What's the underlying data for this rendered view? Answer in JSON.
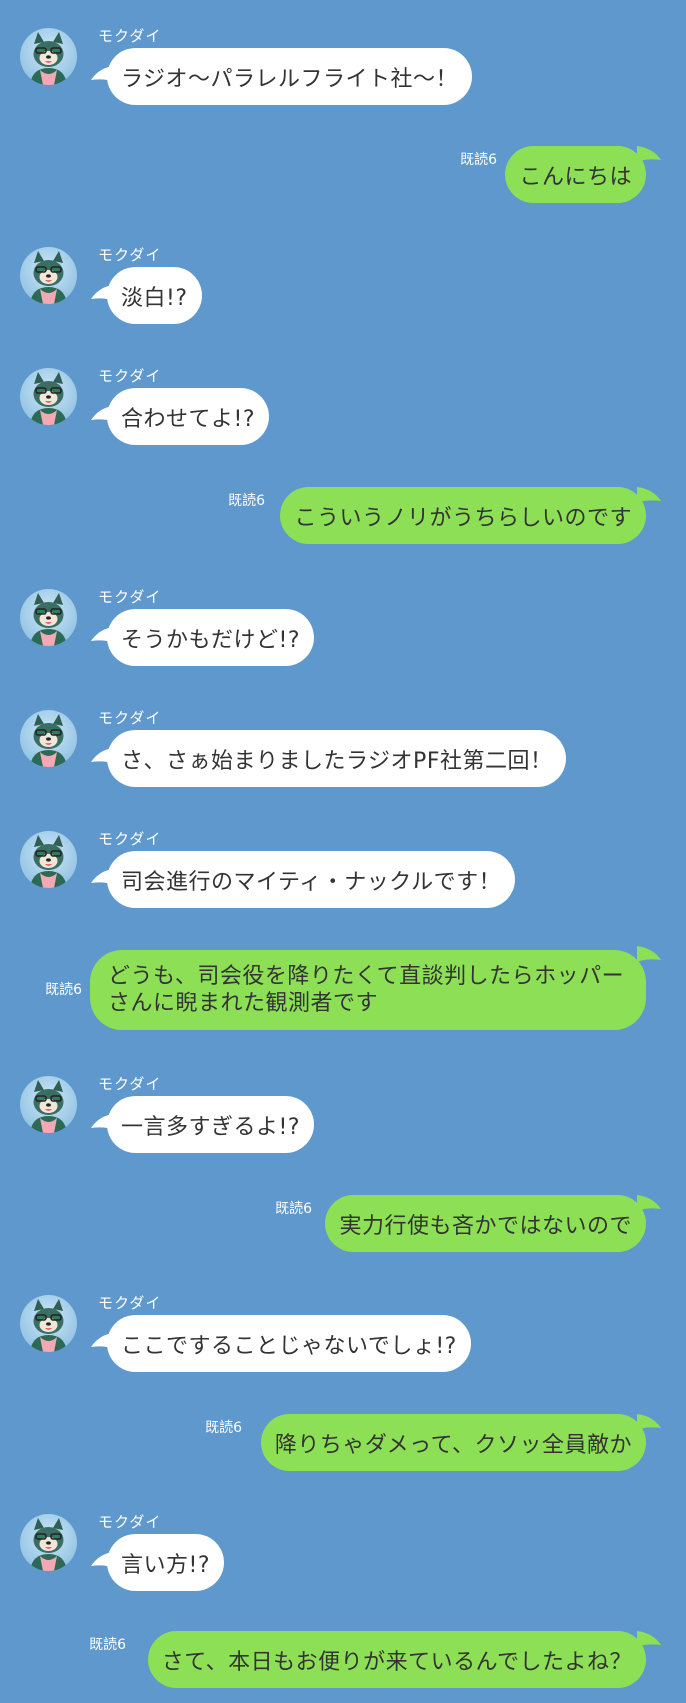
{
  "sender_name": "モクダイ",
  "read_label": "既読6",
  "messages": [
    {
      "side": "in",
      "text": "ラジオ〜パラレルフライト社〜！"
    },
    {
      "side": "out",
      "text": "こんにちは"
    },
    {
      "side": "in",
      "text": "淡白!?"
    },
    {
      "side": "in",
      "text": "合わせてよ!?"
    },
    {
      "side": "out",
      "text": "こういうノリがうちらしいのです"
    },
    {
      "side": "in",
      "text": "そうかもだけど!?"
    },
    {
      "side": "in",
      "text": "さ、さぁ始まりましたラジオPF社第二回！"
    },
    {
      "side": "in",
      "text": "司会進行のマイティ・ナックルです！"
    },
    {
      "side": "out",
      "text": "どうも、司会役を降りたくて直談判したらホッパーさんに睨まれた観測者です"
    },
    {
      "side": "in",
      "text": "一言多すぎるよ!?"
    },
    {
      "side": "out",
      "text": "実力行使も吝かではないので"
    },
    {
      "side": "in",
      "text": "ここですることじゃないでしょ!?"
    },
    {
      "side": "out",
      "text": "降りちゃダメって、クソッ全員敵か"
    },
    {
      "side": "in",
      "text": "言い方!?"
    },
    {
      "side": "out",
      "text": "さて、本日もお便りが来ているんでしたよね？"
    }
  ],
  "colors": {
    "background": "#5e98cd",
    "incoming_bubble": "#ffffff",
    "outgoing_bubble": "#8de055",
    "text": "#333333"
  },
  "icons": {
    "avatar": "wolf-character-avatar"
  }
}
